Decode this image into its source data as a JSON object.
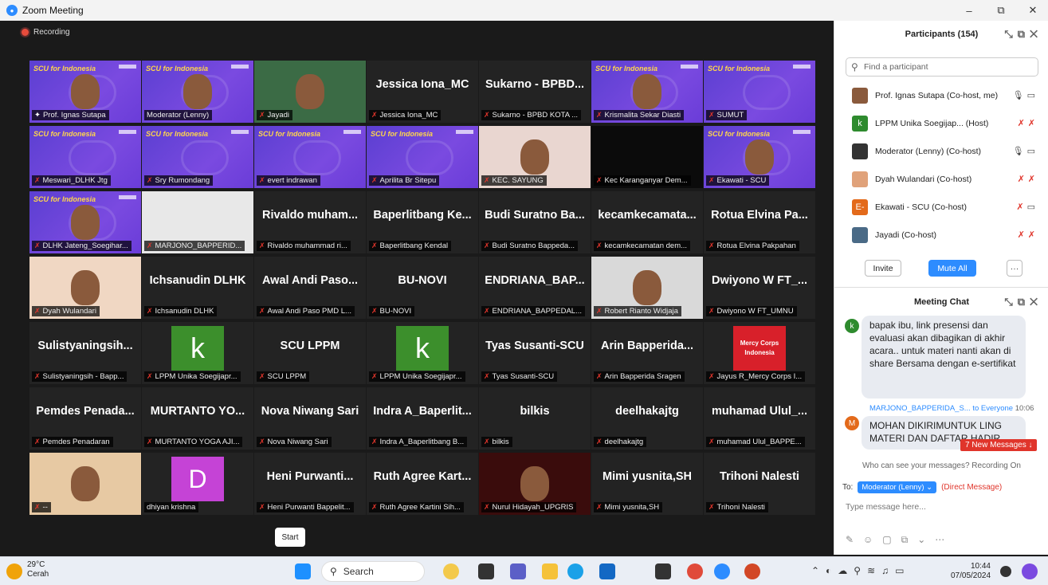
{
  "window": {
    "title": "Zoom Meeting",
    "minimize": "–",
    "restore": "⧉",
    "close": "✕"
  },
  "recording": {
    "label": "Recording"
  },
  "tiles": [
    {
      "kind": "slide",
      "name": "Prof. Ignas Sutapa",
      "active": true,
      "mic": "pin",
      "face": true
    },
    {
      "kind": "slide",
      "name": "Moderator (Lenny)",
      "mic": "none",
      "face": true
    },
    {
      "kind": "cam",
      "name": "Jayadi",
      "mic": "muted",
      "face": true
    },
    {
      "kind": "text",
      "big": "Jessica Iona_MC",
      "name": "Jessica Iona_MC",
      "mic": "muted"
    },
    {
      "kind": "text",
      "big": "Sukarno - BPBD...",
      "name": "Sukarno - BPBD KOTA ...",
      "mic": "muted"
    },
    {
      "kind": "slide",
      "name": "Krismalita Sekar Diasti",
      "mic": "muted",
      "face": true
    },
    {
      "kind": "slide",
      "name": "SUMUT",
      "mic": "muted"
    },
    {
      "kind": "slide",
      "name": "Meswari_DLHK Jtg",
      "mic": "muted"
    },
    {
      "kind": "slide",
      "name": "Sry Rumondang",
      "mic": "muted"
    },
    {
      "kind": "slide",
      "name": "evert indrawan",
      "mic": "muted"
    },
    {
      "kind": "slide",
      "name": "Aprilita Br Sitepu",
      "mic": "muted"
    },
    {
      "kind": "cam",
      "name": "KEC. SAYUNG",
      "mic": "muted",
      "face": true,
      "bg": "#e9d6d0"
    },
    {
      "kind": "cam",
      "name": "Kec Karanganyar Dem...",
      "mic": "muted",
      "bg": "#0b0b0b"
    },
    {
      "kind": "slide",
      "name": "Ekawati - SCU",
      "mic": "muted",
      "face": true
    },
    {
      "kind": "slide",
      "name": "DLHK Jateng_Soegihar...",
      "mic": "muted",
      "face": true
    },
    {
      "kind": "cam",
      "name": "MARJONO_BAPPERID...",
      "mic": "muted",
      "bg": "#e8e8e8"
    },
    {
      "kind": "text",
      "big": "Rivaldo muham...",
      "name": "Rivaldo muhammad ri...",
      "mic": "muted"
    },
    {
      "kind": "text",
      "big": "Baperlitbang Ke...",
      "name": "Baperlitbang Kendal",
      "mic": "muted"
    },
    {
      "kind": "text",
      "big": "Budi Suratno Ba...",
      "name": "Budi Suratno Bappeda...",
      "mic": "muted"
    },
    {
      "kind": "text",
      "big": "kecamkecamata...",
      "name": "kecamkecamatan dem...",
      "mic": "muted"
    },
    {
      "kind": "text",
      "big": "Rotua Elvina Pa...",
      "name": "Rotua Elvina Pakpahan",
      "mic": "muted"
    },
    {
      "kind": "photo",
      "name": "Dyah Wulandari",
      "mic": "muted",
      "bg": "#f0d7c3"
    },
    {
      "kind": "text",
      "big": "Ichsanudin DLHK",
      "name": "Ichsanudin DLHK",
      "mic": "muted"
    },
    {
      "kind": "text",
      "big": "Awal Andi Paso...",
      "name": "Awal Andi Paso PMD L...",
      "mic": "muted"
    },
    {
      "kind": "text",
      "big": "BU-NOVI",
      "name": "BU-NOVI",
      "mic": "muted"
    },
    {
      "kind": "text",
      "big": "ENDRIANA_BAP...",
      "name": "ENDRIANA_BAPPEDAL...",
      "mic": "muted"
    },
    {
      "kind": "photo",
      "name": "Robert Rianto Widjaja",
      "mic": "muted",
      "bg": "#d9d9d9"
    },
    {
      "kind": "text",
      "big": "Dwiyono W FT_...",
      "name": "Dwiyono W FT_UMNU",
      "mic": "muted"
    },
    {
      "kind": "text",
      "big": "Sulistyaningsih...",
      "name": "Sulistyaningsih - Bapp...",
      "mic": "muted"
    },
    {
      "kind": "k",
      "letter": "k",
      "name": "LPPM Unika Soegijapr...",
      "mic": "muted"
    },
    {
      "kind": "text",
      "big": "SCU LPPM",
      "name": "SCU LPPM",
      "mic": "muted"
    },
    {
      "kind": "k",
      "letter": "k",
      "name": "LPPM Unika Soegijapr...",
      "mic": "muted"
    },
    {
      "kind": "text",
      "big": "Tyas Susanti-SCU",
      "name": "Tyas Susanti-SCU",
      "mic": "muted"
    },
    {
      "kind": "text",
      "big": "Arin Bapperida...",
      "name": "Arin Bapperida Sragen",
      "mic": "muted"
    },
    {
      "kind": "mercy",
      "logo": "Mercy Corps Indonesia",
      "name": "Jayus R_Mercy Corps I...",
      "mic": "muted"
    },
    {
      "kind": "text",
      "big": "Pemdes Penada...",
      "name": "Pemdes Penadaran",
      "mic": "muted"
    },
    {
      "kind": "text",
      "big": "MURTANTO YO...",
      "name": "MURTANTO YOGA AJI...",
      "mic": "muted"
    },
    {
      "kind": "text",
      "big": "Nova Niwang Sari",
      "name": "Nova Niwang Sari",
      "mic": "muted"
    },
    {
      "kind": "text",
      "big": "Indra A_Baperlit...",
      "name": "Indra A_Baperlitbang B...",
      "mic": "muted"
    },
    {
      "kind": "text",
      "big": "bilkis",
      "name": "bilkis",
      "mic": "muted"
    },
    {
      "kind": "text",
      "big": "deelhakajtg",
      "name": "deelhakajtg",
      "mic": "muted"
    },
    {
      "kind": "text",
      "big": "muhamad Ulul_...",
      "name": "muhamad Ulul_BAPPE...",
      "mic": "muted"
    },
    {
      "kind": "photo",
      "name": "--",
      "mic": "muted",
      "bg": "#e7c9a3"
    },
    {
      "kind": "d",
      "letter": "D",
      "name": "dhiyan krishna",
      "mic": "none"
    },
    {
      "kind": "text",
      "big": "Heni Purwanti...",
      "name": "Heni Purwanti Bappelit...",
      "mic": "muted"
    },
    {
      "kind": "text",
      "big": "Ruth Agree Kart...",
      "name": "Ruth Agree Kartini Sih...",
      "mic": "muted"
    },
    {
      "kind": "photo",
      "name": "Nurul Hidayah_UPGRIS",
      "mic": "muted",
      "bg": "#3a0c0c"
    },
    {
      "kind": "text",
      "big": "Mimi yusnita,SH",
      "name": "Mimi yusnita,SH",
      "mic": "muted"
    },
    {
      "kind": "text",
      "big": "Trihoni Nalesti",
      "name": "Trihoni Nalesti",
      "mic": "muted"
    }
  ],
  "slide_text": "SCU for Indonesia",
  "start_button": "Start",
  "participants": {
    "title": "Participants (154)",
    "search_placeholder": "Find a participant",
    "list": [
      {
        "name": "Prof. Ignas Sutapa (Co-host, me)",
        "avatar": "",
        "color": "#8a5a3c",
        "status": "mic-cam"
      },
      {
        "name": "LPPM Unika Soegijap... (Host)",
        "avatar": "k",
        "color": "#2e8b2e",
        "status": "muted"
      },
      {
        "name": "Moderator (Lenny) (Co-host)",
        "avatar": "",
        "color": "#333",
        "status": "mic-cam"
      },
      {
        "name": "Dyah Wulandari (Co-host)",
        "avatar": "",
        "color": "#e0a27a",
        "status": "muted"
      },
      {
        "name": "Ekawati - SCU (Co-host)",
        "avatar": "E-",
        "color": "#e36a1b",
        "status": "muted-cam"
      },
      {
        "name": "Jayadi (Co-host)",
        "avatar": "",
        "color": "#4a6a86",
        "status": "muted"
      }
    ],
    "invite": "Invite",
    "mute_all": "Mute All",
    "more": "···"
  },
  "chat": {
    "title": "Meeting Chat",
    "message1": "bapak ibu, link presensi dan evaluasi akan dibagikan di akhir acara.. untuk materi nanti akan di share Bersama dengan e-sertifikat",
    "avatar1": "k",
    "sender2": "MARJONO_BAPPERIDA_S...",
    "to2": "to Everyone",
    "time2": "10:06",
    "avatar2": "M",
    "message2": "MOHAN DIKIRIMUNTUK LING MATERI DAN DAFTAR HADIR",
    "new_messages": "7 New Messages ↓",
    "visibility": "Who can see your messages? Recording On",
    "to_label": "To:",
    "recipient": "Moderator (Lenny) ⌄",
    "direct": "(Direct Message)",
    "input_placeholder": "Type message here..."
  },
  "taskbar": {
    "temp": "29°C",
    "weather": "Cerah",
    "search": "Search",
    "time": "10:44",
    "date": "07/05/2024"
  }
}
